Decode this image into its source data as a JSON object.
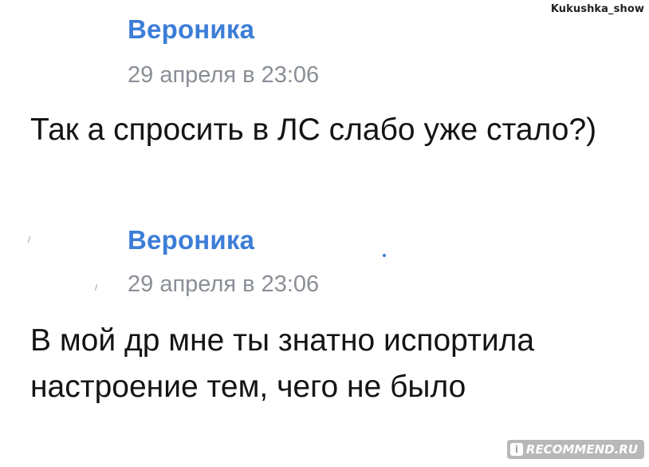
{
  "watermark": {
    "top_right": "Kukushka_show",
    "bottom_right": "RECOMMEND.RU"
  },
  "messages": [
    {
      "author": "Вероника",
      "time": "29 апреля в 23:06",
      "text": "Так а спросить в ЛС слабо уже стало?)"
    },
    {
      "author": "Вероника",
      "time": "29 апреля в 23:06",
      "text": "В мой др мне ты знатно испортила настроение тем, чего не было"
    }
  ],
  "colors": {
    "author": "#3c7dd7",
    "time": "#8a8f96",
    "text": "#141414",
    "background": "#ffffff"
  }
}
